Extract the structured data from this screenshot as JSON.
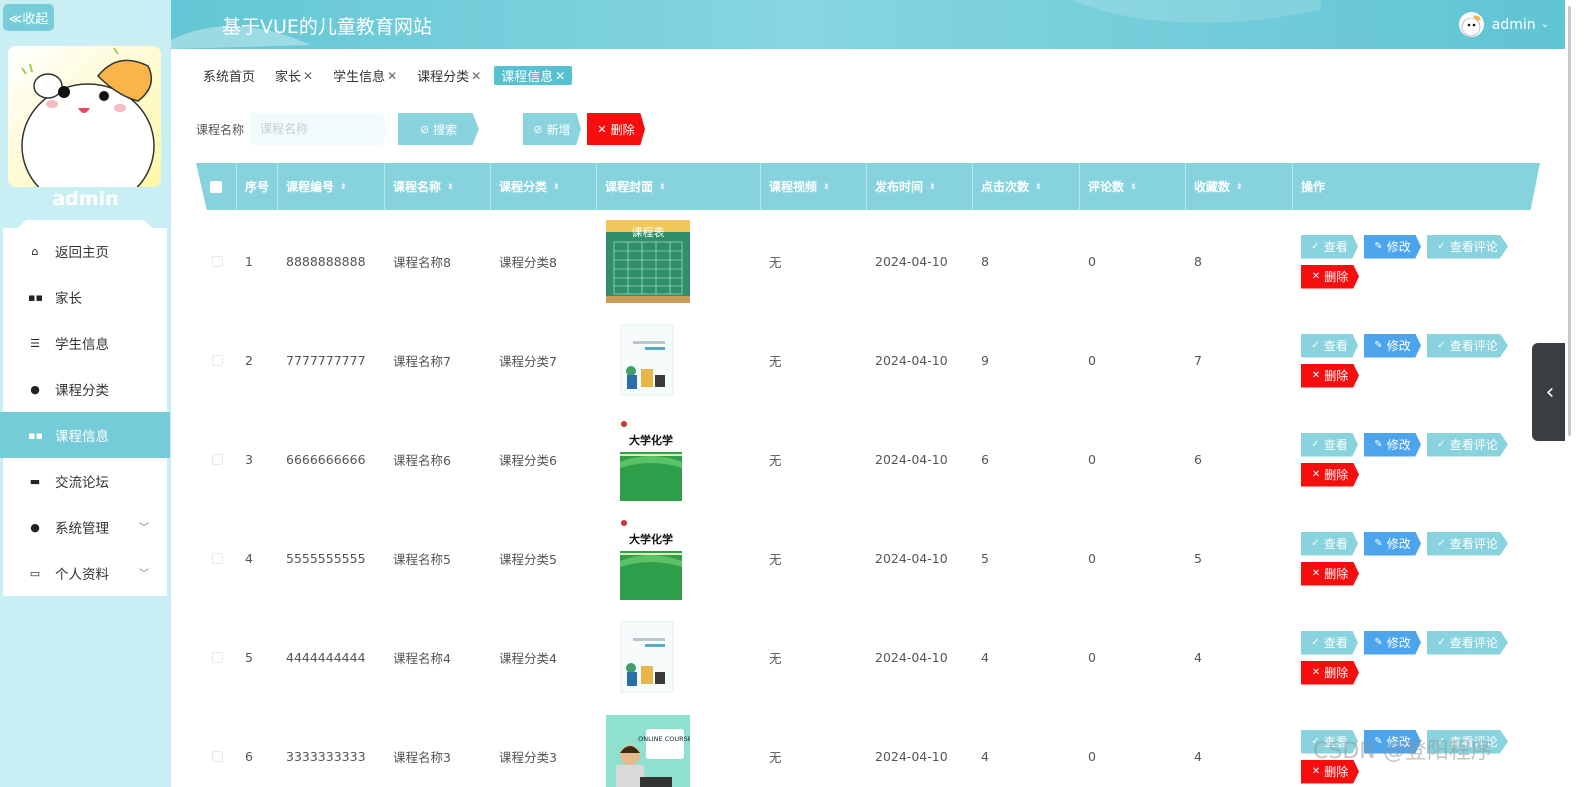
{
  "sidebar": {
    "collapse_label": "≪收起",
    "username": "admin",
    "items": [
      {
        "label": "返回主页",
        "icon": "home-icon",
        "glyph": "⌂"
      },
      {
        "label": "家长",
        "icon": "grid-icon",
        "glyph": "▪▪"
      },
      {
        "label": "学生信息",
        "icon": "list-icon",
        "glyph": "☰"
      },
      {
        "label": "课程分类",
        "icon": "user-icon",
        "glyph": "●"
      },
      {
        "label": "课程信息",
        "icon": "grid-icon",
        "glyph": "▪▪"
      },
      {
        "label": "交流论坛",
        "icon": "book-icon",
        "glyph": "▬"
      },
      {
        "label": "系统管理",
        "icon": "bulb-icon",
        "glyph": "●"
      },
      {
        "label": "个人资料",
        "icon": "card-icon",
        "glyph": "▭"
      }
    ]
  },
  "header": {
    "title": "基于VUE的儿童教育网站",
    "user": "admin"
  },
  "tabs": [
    {
      "label": "系统首页",
      "closable": false
    },
    {
      "label": "家长",
      "closable": true
    },
    {
      "label": "学生信息",
      "closable": true
    },
    {
      "label": "课程分类",
      "closable": true
    },
    {
      "label": "课程信息",
      "closable": true
    }
  ],
  "search": {
    "label": "课程名称",
    "placeholder": "课程名称",
    "search_btn": "搜索",
    "add_btn": "新增",
    "delete_btn": "删除"
  },
  "table": {
    "columns": [
      "序号",
      "课程编号",
      "课程名称",
      "课程分类",
      "课程封面",
      "课程视频",
      "发布时间",
      "点击次数",
      "评论数",
      "收藏数",
      "操作"
    ],
    "actions": {
      "view": "查看",
      "edit": "修改",
      "comments": "查看评论",
      "delete": "删除"
    },
    "rows": [
      {
        "no": "1",
        "code": "8888888888",
        "name": "课程名称8",
        "category": "课程分类8",
        "cover": "schedule",
        "video": "无",
        "date": "2024-04-10",
        "clicks": "8",
        "comments": "0",
        "favorites": "8"
      },
      {
        "no": "2",
        "code": "7777777777",
        "name": "课程名称7",
        "category": "课程分类7",
        "cover": "bookwhite",
        "video": "无",
        "date": "2024-04-10",
        "clicks": "9",
        "comments": "0",
        "favorites": "7"
      },
      {
        "no": "3",
        "code": "6666666666",
        "name": "课程名称6",
        "category": "课程分类6",
        "cover": "chem",
        "video": "无",
        "date": "2024-04-10",
        "clicks": "6",
        "comments": "0",
        "favorites": "6"
      },
      {
        "no": "4",
        "code": "5555555555",
        "name": "课程名称5",
        "category": "课程分类5",
        "cover": "chem",
        "video": "无",
        "date": "2024-04-10",
        "clicks": "5",
        "comments": "0",
        "favorites": "5"
      },
      {
        "no": "5",
        "code": "4444444444",
        "name": "课程名称4",
        "category": "课程分类4",
        "cover": "bookwhite",
        "video": "无",
        "date": "2024-04-10",
        "clicks": "4",
        "comments": "0",
        "favorites": "4"
      },
      {
        "no": "6",
        "code": "3333333333",
        "name": "课程名称3",
        "category": "课程分类3",
        "cover": "online",
        "video": "无",
        "date": "2024-04-10",
        "clicks": "4",
        "comments": "0",
        "favorites": "4"
      }
    ]
  },
  "covers": {
    "schedule_title": "课程表",
    "chem_title": "大学化学",
    "online_title": "ONLINE COURSE"
  },
  "watermark": "CSDN @登阳程序",
  "colors": {
    "accent": "#75ccd8",
    "danger": "#f40e0e",
    "edit": "#4ca4ec"
  }
}
